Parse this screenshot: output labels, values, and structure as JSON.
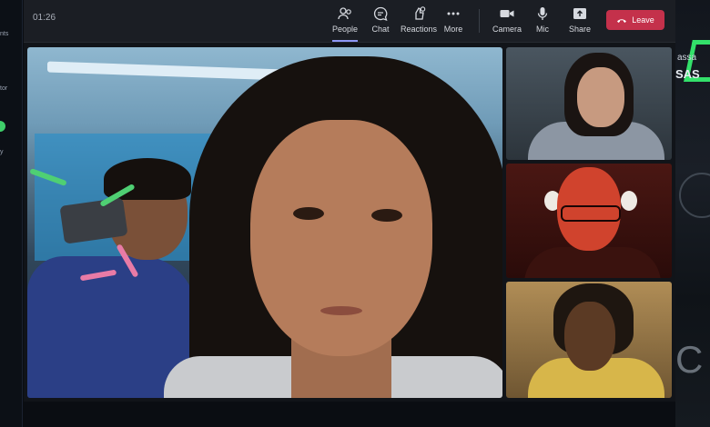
{
  "left_panel": {
    "items": [
      "nts",
      "tor",
      "y"
    ]
  },
  "right_panel": {
    "text1": "assa",
    "text2": "SAS",
    "text3": "C"
  },
  "meeting": {
    "elapsed_time": "01:26",
    "toolbar": {
      "people": {
        "label": "People",
        "icon": "people-icon",
        "active": true
      },
      "chat": {
        "label": "Chat",
        "icon": "chat-icon"
      },
      "reactions": {
        "label": "Reactions",
        "icon": "reactions-icon"
      },
      "more": {
        "label": "More",
        "icon": "more-icon"
      },
      "camera": {
        "label": "Camera",
        "icon": "camera-icon"
      },
      "mic": {
        "label": "Mic",
        "icon": "mic-icon"
      },
      "share": {
        "label": "Share",
        "icon": "share-icon"
      },
      "leave": {
        "label": "Leave",
        "icon": "phone-hangup-icon",
        "color": "#c4314b"
      }
    },
    "accent_color": "#8d97f5"
  }
}
